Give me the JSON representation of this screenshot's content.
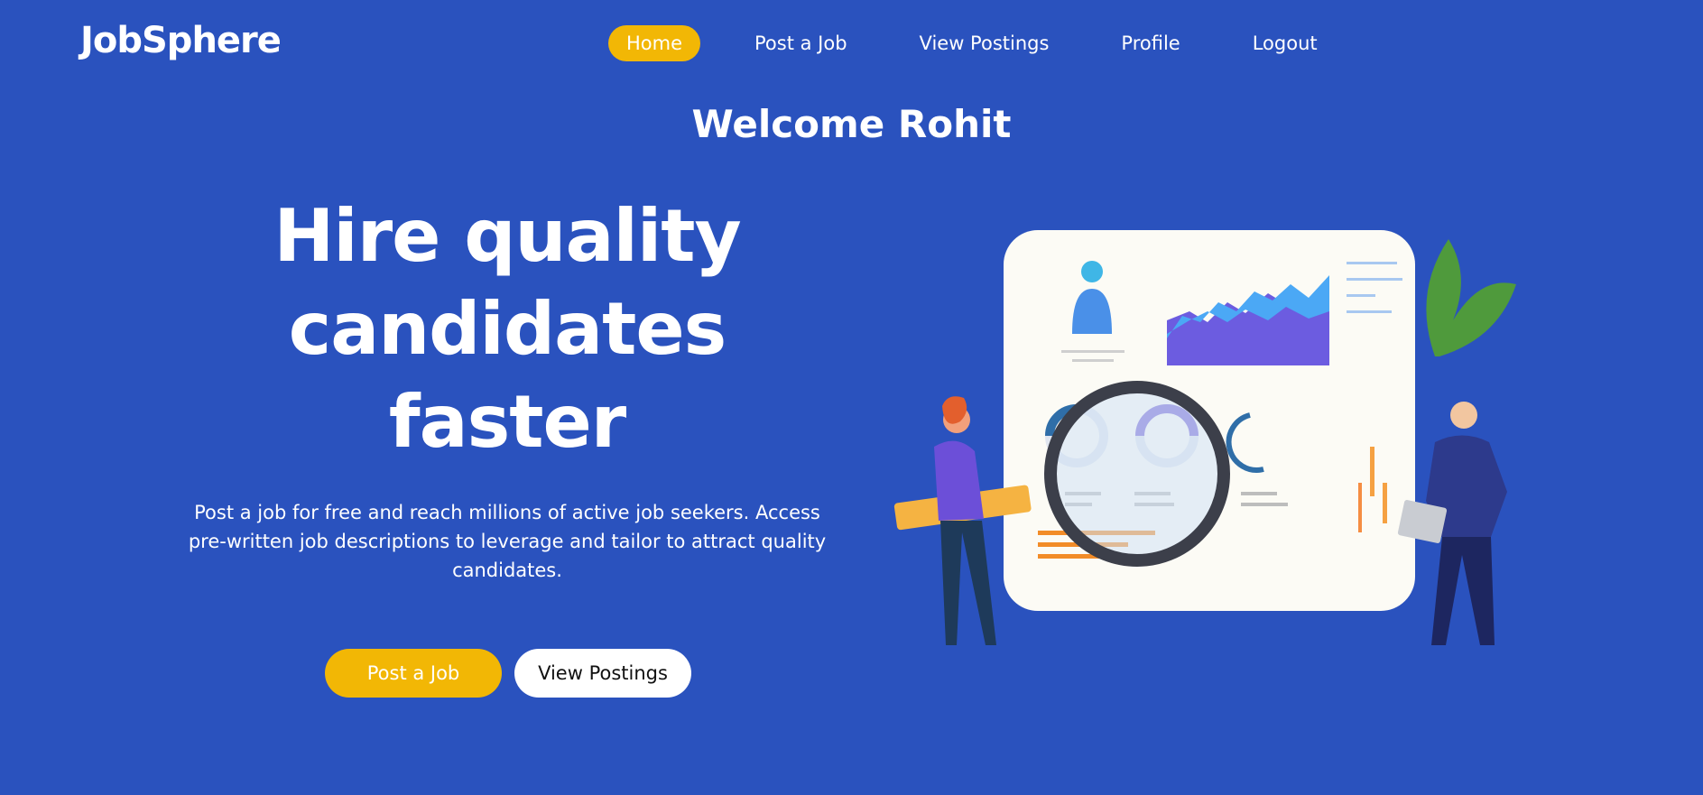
{
  "brand": {
    "name": "JobSphere"
  },
  "nav": {
    "items": [
      {
        "label": "Home",
        "active": true
      },
      {
        "label": "Post a Job",
        "active": false
      },
      {
        "label": "View Postings",
        "active": false
      },
      {
        "label": "Profile",
        "active": false
      },
      {
        "label": "Logout",
        "active": false
      }
    ]
  },
  "welcome": {
    "text": "Welcome Rohit"
  },
  "hero": {
    "title_line1": "Hire quality",
    "title_line2": "candidates",
    "title_line3": "faster",
    "description": "Post a job for free and reach millions of active job seekers. Access pre-written job descriptions to leverage and tailor to attract quality candidates.",
    "primary_button": "Post a Job",
    "secondary_button": "View Postings"
  },
  "colors": {
    "background": "#2a52be",
    "accent": "#f2b705",
    "text": "#ffffff"
  },
  "illustration": {
    "icon": "recruitment-search-illustration"
  }
}
